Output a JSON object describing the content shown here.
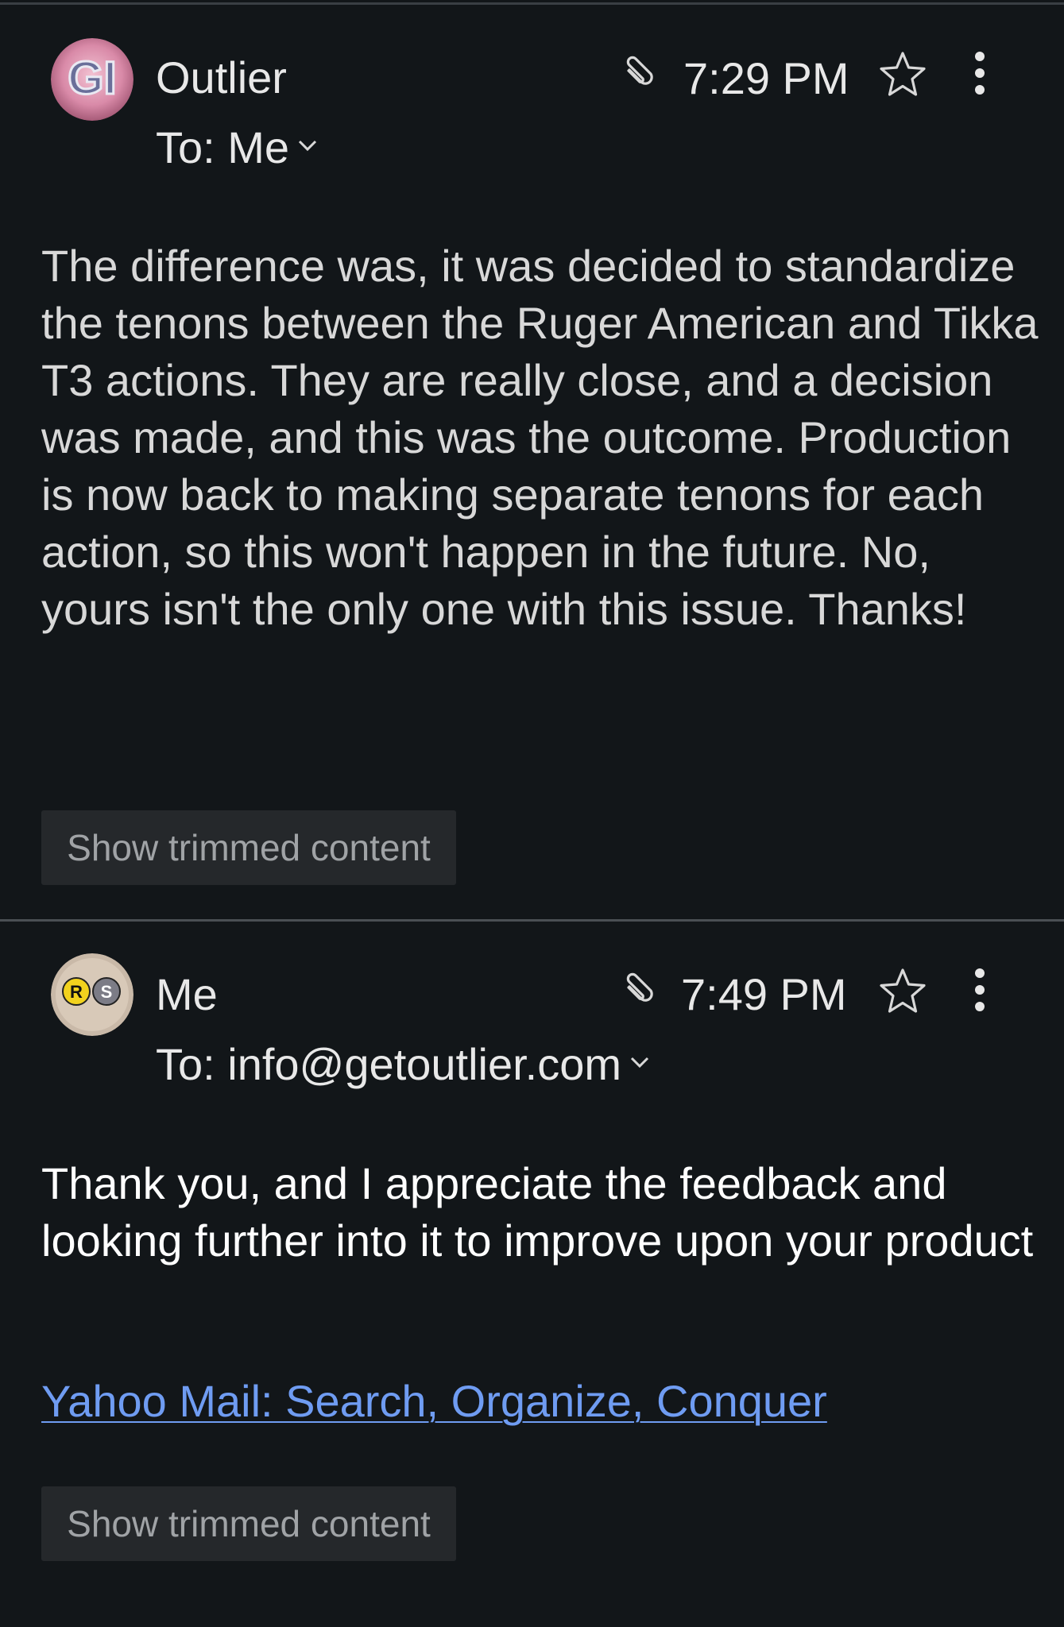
{
  "thread": {
    "messages": [
      {
        "sender": "Outlier",
        "recipient": "To: Me",
        "time": "7:29 PM",
        "avatar_text": "GI",
        "body": "The difference was, it was decided to standardize the tenons between the Ruger American and Tikka T3 actions. They are really close, and a decision was made, and this was the outcome. Production is now back to making separate tenons for each action, so this won't happen in the future. No, yours isn't the only one with this issue. Thanks!",
        "show_trimmed_label": "Show trimmed content",
        "icons": [
          "paperclip-icon",
          "star-icon",
          "more-vertical-icon",
          "chevron-down-icon"
        ]
      },
      {
        "sender": "Me",
        "recipient": "To: info@getoutlier.com",
        "time": "7:49 PM",
        "avatar_text": [
          "R",
          "S"
        ],
        "body": "Thank you, and I appreciate the feedback and looking further into it to improve upon your product",
        "signature_link": "Yahoo Mail: Search, Organize, Conquer",
        "show_trimmed_label": "Show trimmed content",
        "icons": [
          "paperclip-icon",
          "star-icon",
          "more-vertical-icon",
          "chevron-down-icon"
        ]
      }
    ]
  },
  "colors": {
    "background": "#121619",
    "text": "#e8e8e8",
    "link": "#6f9cf2",
    "button_bg": "#25282b",
    "button_text": "#a0a3a6"
  }
}
